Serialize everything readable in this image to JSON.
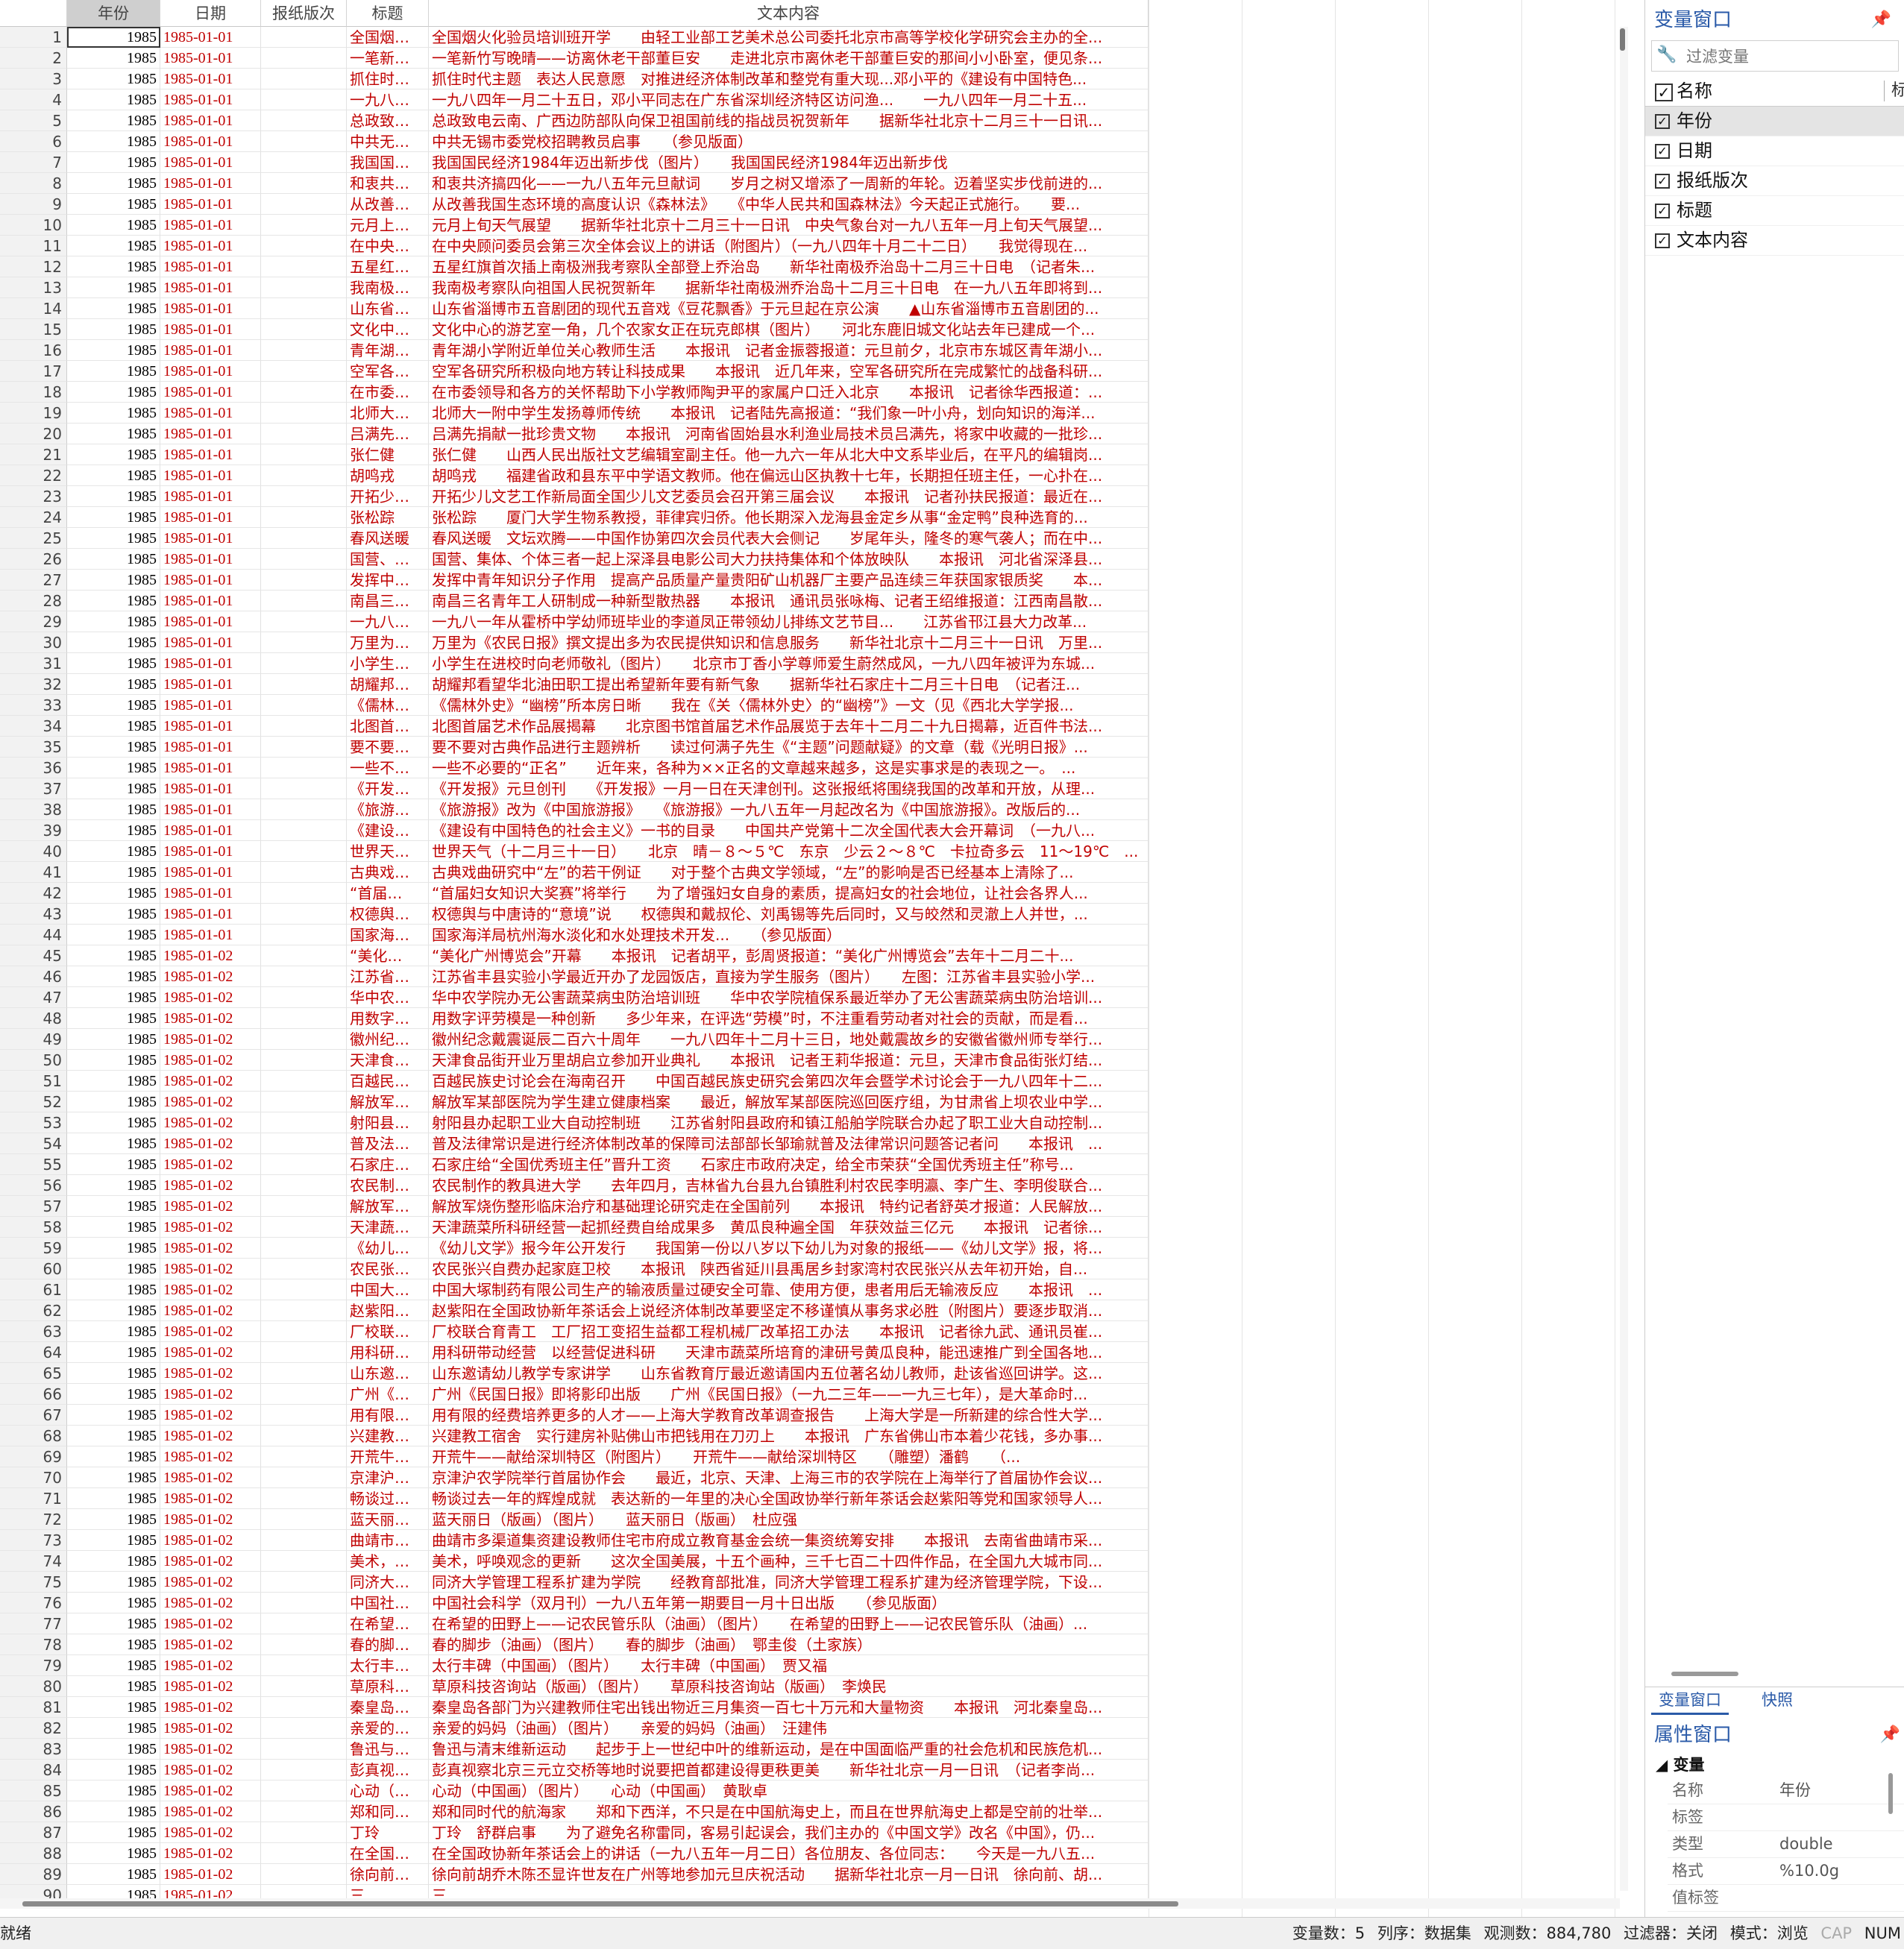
{
  "grid": {
    "headers": [
      "年份",
      "日期",
      "报纸版次",
      "标题",
      "文本内容"
    ],
    "rows": [
      {
        "n": "1",
        "year": "1985",
        "date": "1985-01-01",
        "edition": "",
        "title": "全国烟…",
        "text": "全国烟火化验员培训班开学　　由轻工业部工艺美术总公司委托北京市高等学校化学研究会主办的全..."
      },
      {
        "n": "2",
        "year": "1985",
        "date": "1985-01-01",
        "edition": "",
        "title": "一笔新…",
        "text": "一笔新竹写晚晴——访离休老干部董巨安　　走进北京市离休老干部董巨安的那间小小卧室，便见条..."
      },
      {
        "n": "3",
        "year": "1985",
        "date": "1985-01-01",
        "edition": "",
        "title": "抓住时…",
        "text": "抓住时代主题　表达人民意愿　对推进经济体制改革和整党有重大现...邓小平的《建设有中国特色..."
      },
      {
        "n": "4",
        "year": "1985",
        "date": "1985-01-01",
        "edition": "",
        "title": "一九八…",
        "text": "一九八四年一月二十五日，邓小平同志在广东省深圳经济特区访问渔...　　一九八四年一月二十五..."
      },
      {
        "n": "5",
        "year": "1985",
        "date": "1985-01-01",
        "edition": "",
        "title": "总政致…",
        "text": "总政致电云南、广西边防部队向保卫祖国前线的指战员祝贺新年　　据新华社北京十二月三十一日讯..."
      },
      {
        "n": "6",
        "year": "1985",
        "date": "1985-01-01",
        "edition": "",
        "title": "中共无…",
        "text": "中共无锡市委党校招聘教员启事　　（参见版面）"
      },
      {
        "n": "7",
        "year": "1985",
        "date": "1985-01-01",
        "edition": "",
        "title": "我国国…",
        "text": "我国国民经济1984年迈出新步伐（图片）　　我国国民经济1984年迈出新步伐"
      },
      {
        "n": "8",
        "year": "1985",
        "date": "1985-01-01",
        "edition": "",
        "title": "和衷共…",
        "text": "和衷共济搞四化——一九八五年元旦献词　　岁月之树又增添了一周新的年轮。迈着坚实步伐前进的..."
      },
      {
        "n": "9",
        "year": "1985",
        "date": "1985-01-01",
        "edition": "",
        "title": "从改善…",
        "text": "从改善我国生态环境的高度认识《森林法》　　《中华人民共和国森林法》今天起正式施行。　　要..."
      },
      {
        "n": "10",
        "year": "1985",
        "date": "1985-01-01",
        "edition": "",
        "title": "元月上…",
        "text": "元月上旬天气展望　　据新华社北京十二月三十一日讯　中央气象台对一九八五年一月上旬天气展望..."
      },
      {
        "n": "11",
        "year": "1985",
        "date": "1985-01-01",
        "edition": "",
        "title": "在中央…",
        "text": "在中央顾问委员会第三次全体会议上的讲话（附图片）（一九八四年十月二十二日）　　我觉得现在..."
      },
      {
        "n": "12",
        "year": "1985",
        "date": "1985-01-01",
        "edition": "",
        "title": "五星红…",
        "text": "五星红旗首次插上南极洲我考察队全部登上乔治岛　　新华社南极乔治岛十二月三十日电　（记者朱..."
      },
      {
        "n": "13",
        "year": "1985",
        "date": "1985-01-01",
        "edition": "",
        "title": "我南极…",
        "text": "我南极考察队向祖国人民祝贺新年　　据新华社南极洲乔治岛十二月三十日电　在一九八五年即将到..."
      },
      {
        "n": "14",
        "year": "1985",
        "date": "1985-01-01",
        "edition": "",
        "title": "山东省…",
        "text": "山东省淄博市五音剧团的现代五音戏《豆花飘香》于元旦起在京公演　　▲山东省淄博市五音剧团的..."
      },
      {
        "n": "15",
        "year": "1985",
        "date": "1985-01-01",
        "edition": "",
        "title": "文化中…",
        "text": "文化中心的游艺室一角，几个农家女正在玩克郎棋（图片）　　河北东鹿旧城文化站去年已建成一个..."
      },
      {
        "n": "16",
        "year": "1985",
        "date": "1985-01-01",
        "edition": "",
        "title": "青年湖…",
        "text": "青年湖小学附近单位关心教师生活　　本报讯　记者金振蓉报道：元旦前夕，北京市东城区青年湖小..."
      },
      {
        "n": "17",
        "year": "1985",
        "date": "1985-01-01",
        "edition": "",
        "title": "空军各…",
        "text": "空军各研究所积极向地方转让科技成果　　本报讯　近几年来，空军各研究所在完成繁忙的战备科研..."
      },
      {
        "n": "18",
        "year": "1985",
        "date": "1985-01-01",
        "edition": "",
        "title": "在市委…",
        "text": "在市委领导和各方的关怀帮助下小学教师陶尹平的家属户口迁入北京　　本报讯　记者徐华西报道：..."
      },
      {
        "n": "19",
        "year": "1985",
        "date": "1985-01-01",
        "edition": "",
        "title": "北师大…",
        "text": "北师大一附中学生发扬尊师传统　　本报讯　记者陆先高报道：“我们象一叶小舟，划向知识的海洋..."
      },
      {
        "n": "20",
        "year": "1985",
        "date": "1985-01-01",
        "edition": "",
        "title": "吕满先…",
        "text": "吕满先捐献一批珍贵文物　　本报讯　河南省固始县水利渔业局技术员吕满先，将家中收藏的一批珍..."
      },
      {
        "n": "21",
        "year": "1985",
        "date": "1985-01-01",
        "edition": "",
        "title": "张仁健",
        "text": "张仁健　　山西人民出版社文艺编辑室副主任。他一九六一年从北大中文系毕业后，在平凡的编辑岗..."
      },
      {
        "n": "22",
        "year": "1985",
        "date": "1985-01-01",
        "edition": "",
        "title": "胡鸣戎",
        "text": "胡鸣戎　　福建省政和县东平中学语文教师。他在偏远山区执教十七年，长期担任班主任，一心扑在..."
      },
      {
        "n": "23",
        "year": "1985",
        "date": "1985-01-01",
        "edition": "",
        "title": "开拓少…",
        "text": "开拓少儿文艺工作新局面全国少儿文艺委员会召开第三届会议　　本报讯　记者孙扶民报道：最近在..."
      },
      {
        "n": "24",
        "year": "1985",
        "date": "1985-01-01",
        "edition": "",
        "title": "张松踪",
        "text": "张松踪　　厦门大学生物系教授，菲律宾归侨。他长期深入龙海县金定乡从事“金定鸭”良种选育的..."
      },
      {
        "n": "25",
        "year": "1985",
        "date": "1985-01-01",
        "edition": "",
        "title": "春风送暖",
        "text": "春风送暖　文坛欢腾——中国作协第四次会员代表大会侧记　　岁尾年头，隆冬的寒气袭人；而在中..."
      },
      {
        "n": "26",
        "year": "1985",
        "date": "1985-01-01",
        "edition": "",
        "title": "国营、…",
        "text": "国营、集体、个体三者一起上深泽县电影公司大力扶持集体和个体放映队　　本报讯　河北省深泽县..."
      },
      {
        "n": "27",
        "year": "1985",
        "date": "1985-01-01",
        "edition": "",
        "title": "发挥中…",
        "text": "发挥中青年知识分子作用　提高产品质量产量贵阳矿山机器厂主要产品连续三年获国家银质奖　　本..."
      },
      {
        "n": "28",
        "year": "1985",
        "date": "1985-01-01",
        "edition": "",
        "title": "南昌三…",
        "text": "南昌三名青年工人研制成一种新型散热器　　本报讯　通讯员张咏梅、记者王绍维报道：江西南昌散..."
      },
      {
        "n": "29",
        "year": "1985",
        "date": "1985-01-01",
        "edition": "",
        "title": "一九八…",
        "text": "一九八一年从霍桥中学幼师班毕业的李道凤正带领幼儿排练文艺节目...　　江苏省邗江县大力改革..."
      },
      {
        "n": "30",
        "year": "1985",
        "date": "1985-01-01",
        "edition": "",
        "title": "万里为…",
        "text": "万里为《农民日报》撰文提出多为农民提供知识和信息服务　　新华社北京十二月三十一日讯　万里..."
      },
      {
        "n": "31",
        "year": "1985",
        "date": "1985-01-01",
        "edition": "",
        "title": "小学生…",
        "text": "小学生在进校时向老师敬礼（图片）　　北京市丁香小学尊师爱生蔚然成风，一九八四年被评为东城..."
      },
      {
        "n": "32",
        "year": "1985",
        "date": "1985-01-01",
        "edition": "",
        "title": "胡耀邦…",
        "text": "胡耀邦看望华北油田职工提出希望新年要有新气象　　据新华社石家庄十二月三十日电　（记者汪..."
      },
      {
        "n": "33",
        "year": "1985",
        "date": "1985-01-01",
        "edition": "",
        "title": "《儒林…",
        "text": "《儒林外史》“幽榜”所本房日晰　　我在《关〈儒林外史〉的“幽榜”》一文（见《西北大学学报..."
      },
      {
        "n": "34",
        "year": "1985",
        "date": "1985-01-01",
        "edition": "",
        "title": "北图首…",
        "text": "北图首届艺术作品展揭幕　　北京图书馆首届艺术作品展览于去年十二月二十九日揭幕，近百件书法..."
      },
      {
        "n": "35",
        "year": "1985",
        "date": "1985-01-01",
        "edition": "",
        "title": "要不要…",
        "text": "要不要对古典作品进行主题辨析　　读过何满子先生《“主题”问题献疑》的文章（载《光明日报》..."
      },
      {
        "n": "36",
        "year": "1985",
        "date": "1985-01-01",
        "edition": "",
        "title": "一些不…",
        "text": "一些不必要的“正名”　　近年来，各种为××正名的文章越来越多，这是实事求是的表现之一。　..."
      },
      {
        "n": "37",
        "year": "1985",
        "date": "1985-01-01",
        "edition": "",
        "title": "《开发…",
        "text": "《开发报》元旦创刊　　《开发报》一月一日在天津创刊。这张报纸将围绕我国的改革和开放，从理..."
      },
      {
        "n": "38",
        "year": "1985",
        "date": "1985-01-01",
        "edition": "",
        "title": "《旅游…",
        "text": "《旅游报》改为《中国旅游报》　　《旅游报》一九八五年一月起改名为《中国旅游报》。改版后的..."
      },
      {
        "n": "39",
        "year": "1985",
        "date": "1985-01-01",
        "edition": "",
        "title": "《建设…",
        "text": "《建设有中国特色的社会主义》一书的目录　　中国共产党第十二次全国代表大会开幕词　（一九八..."
      },
      {
        "n": "40",
        "year": "1985",
        "date": "1985-01-01",
        "edition": "",
        "title": "世界天…",
        "text": "世界天气（十二月三十一日）　　北京　晴－８～５℃　东京　少云２～８℃　卡拉奇多云　11～19℃　..."
      },
      {
        "n": "41",
        "year": "1985",
        "date": "1985-01-01",
        "edition": "",
        "title": "古典戏…",
        "text": "古典戏曲研究中“左”的若干例证　　对于整个古典文学领域，“左”的影响是否已经基本上清除了..."
      },
      {
        "n": "42",
        "year": "1985",
        "date": "1985-01-01",
        "edition": "",
        "title": "“首届…",
        "text": "“首届妇女知识大奖赛”将举行　　为了增强妇女自身的素质，提高妇女的社会地位，让社会各界人..."
      },
      {
        "n": "43",
        "year": "1985",
        "date": "1985-01-01",
        "edition": "",
        "title": "权德舆…",
        "text": "权德舆与中唐诗的“意境”说　　权德舆和戴叔伦、刘禹锡等先后同时，又与皎然和灵澈上人并世，..."
      },
      {
        "n": "44",
        "year": "1985",
        "date": "1985-01-01",
        "edition": "",
        "title": "国家海…",
        "text": "国家海洋局杭州海水淡化和水处理技术开发...　　（参见版面）"
      },
      {
        "n": "45",
        "year": "1985",
        "date": "1985-01-02",
        "edition": "",
        "title": "“美化…",
        "text": "“美化广州博览会”开幕　　本报讯　记者胡平，彭周贤报道：“美化广州博览会”去年十二月二十..."
      },
      {
        "n": "46",
        "year": "1985",
        "date": "1985-01-02",
        "edition": "",
        "title": "江苏省…",
        "text": "江苏省丰县实验小学最近开办了龙园饭店，直接为学生服务（图片）　　左图：江苏省丰县实验小学..."
      },
      {
        "n": "47",
        "year": "1985",
        "date": "1985-01-02",
        "edition": "",
        "title": "华中农…",
        "text": "华中农学院办无公害蔬菜病虫防治培训班　　华中农学院植保系最近举办了无公害蔬菜病虫防治培训..."
      },
      {
        "n": "48",
        "year": "1985",
        "date": "1985-01-02",
        "edition": "",
        "title": "用数字…",
        "text": "用数字评劳模是一种创新　　多少年来，在评选“劳模”时，不注重看劳动者对社会的贡献，而是看..."
      },
      {
        "n": "49",
        "year": "1985",
        "date": "1985-01-02",
        "edition": "",
        "title": "徽州纪…",
        "text": "徽州纪念戴震诞辰二百六十周年　　一九八四年十二月十三日，地处戴震故乡的安徽省徽州师专举行..."
      },
      {
        "n": "50",
        "year": "1985",
        "date": "1985-01-02",
        "edition": "",
        "title": "天津食…",
        "text": "天津食品街开业万里胡启立参加开业典礼　　本报讯　记者王莉华报道：元旦，天津市食品街张灯结..."
      },
      {
        "n": "51",
        "year": "1985",
        "date": "1985-01-02",
        "edition": "",
        "title": "百越民…",
        "text": "百越民族史讨论会在海南召开　　中国百越民族史研究会第四次年会暨学术讨论会于一九八四年十二..."
      },
      {
        "n": "52",
        "year": "1985",
        "date": "1985-01-02",
        "edition": "",
        "title": "解放军…",
        "text": "解放军某部医院为学生建立健康档案　　最近，解放军某部医院巡回医疗组，为甘肃省上坝农业中学..."
      },
      {
        "n": "53",
        "year": "1985",
        "date": "1985-01-02",
        "edition": "",
        "title": "射阳县…",
        "text": "射阳县办起职工业大自动控制班　　江苏省射阳县政府和镇江船舶学院联合办起了职工业大自动控制..."
      },
      {
        "n": "54",
        "year": "1985",
        "date": "1985-01-02",
        "edition": "",
        "title": "普及法…",
        "text": "普及法律常识是进行经济体制改革的保障司法部部长邹瑜就普及法律常识问题答记者问　　本报讯　..."
      },
      {
        "n": "55",
        "year": "1985",
        "date": "1985-01-02",
        "edition": "",
        "title": "石家庄…",
        "text": "石家庄给“全国优秀班主任”晋升工资　　石家庄市政府决定，给全市荣获“全国优秀班主任”称号..."
      },
      {
        "n": "56",
        "year": "1985",
        "date": "1985-01-02",
        "edition": "",
        "title": "农民制…",
        "text": "农民制作的教具进大学　　去年四月，吉林省九台县九台镇胜利村农民李明瀛、李广生、李明俊联合..."
      },
      {
        "n": "57",
        "year": "1985",
        "date": "1985-01-02",
        "edition": "",
        "title": "解放军…",
        "text": "解放军烧伤整形临床治疗和基础理论研究走在全国前列　　本报讯　特约记者舒英才报道：人民解放..."
      },
      {
        "n": "58",
        "year": "1985",
        "date": "1985-01-02",
        "edition": "",
        "title": "天津蔬…",
        "text": "天津蔬菜所科研经营一起抓经费自给成果多　黄瓜良种遍全国　年获效益三亿元　　本报讯　记者徐..."
      },
      {
        "n": "59",
        "year": "1985",
        "date": "1985-01-02",
        "edition": "",
        "title": "《幼儿…",
        "text": "《幼儿文学》报今年公开发行　　我国第一份以八岁以下幼儿为对象的报纸——《幼儿文学》报，将..."
      },
      {
        "n": "60",
        "year": "1985",
        "date": "1985-01-02",
        "edition": "",
        "title": "农民张…",
        "text": "农民张兴自费办起家庭卫校　　本报讯　陕西省延川县禹居乡封家湾村农民张兴从去年初开始，自..."
      },
      {
        "n": "61",
        "year": "1985",
        "date": "1985-01-02",
        "edition": "",
        "title": "中国大…",
        "text": "中国大塚制药有限公司生产的输液质量过硬安全可靠、使用方便，患者用后无输液反应　　本报讯　..."
      },
      {
        "n": "62",
        "year": "1985",
        "date": "1985-01-02",
        "edition": "",
        "title": "赵紫阳…",
        "text": "赵紫阳在全国政协新年茶话会上说经济体制改革要坚定不移谨慎从事务求必胜（附图片）要逐步取消..."
      },
      {
        "n": "63",
        "year": "1985",
        "date": "1985-01-02",
        "edition": "",
        "title": "厂校联…",
        "text": "厂校联合育青工　工厂招工变招生益都工程机械厂改革招工办法　　本报讯　记者徐九武、通讯员崔..."
      },
      {
        "n": "64",
        "year": "1985",
        "date": "1985-01-02",
        "edition": "",
        "title": "用科研…",
        "text": "用科研带动经营　以经营促进科研　　天津市蔬菜所培育的津研号黄瓜良种，能迅速推广到全国各地..."
      },
      {
        "n": "65",
        "year": "1985",
        "date": "1985-01-02",
        "edition": "",
        "title": "山东邀…",
        "text": "山东邀请幼儿教学专家讲学　　山东省教育厅最近邀请国内五位著名幼儿教师，赴该省巡回讲学。这..."
      },
      {
        "n": "66",
        "year": "1985",
        "date": "1985-01-02",
        "edition": "",
        "title": "广州《…",
        "text": "广州《民国日报》即将影印出版　　广州《民国日报》（一九二三年——一九三七年），是大革命时..."
      },
      {
        "n": "67",
        "year": "1985",
        "date": "1985-01-02",
        "edition": "",
        "title": "用有限…",
        "text": "用有限的经费培养更多的人才——上海大学教育改革调查报告　　上海大学是一所新建的综合性大学..."
      },
      {
        "n": "68",
        "year": "1985",
        "date": "1985-01-02",
        "edition": "",
        "title": "兴建教…",
        "text": "兴建教工宿舍　实行建房补贴佛山市把钱用在刀刃上　　本报讯　广东省佛山市本着少花钱，多办事..."
      },
      {
        "n": "69",
        "year": "1985",
        "date": "1985-01-02",
        "edition": "",
        "title": "开荒牛…",
        "text": "开荒牛——献给深圳特区（附图片）　　开荒牛——献给深圳特区　　（雕塑）潘鹤　　（..."
      },
      {
        "n": "70",
        "year": "1985",
        "date": "1985-01-02",
        "edition": "",
        "title": "京津沪…",
        "text": "京津沪农学院举行首届协作会　　最近，北京、天津、上海三市的农学院在上海举行了首届协作会议..."
      },
      {
        "n": "71",
        "year": "1985",
        "date": "1985-01-02",
        "edition": "",
        "title": "畅谈过…",
        "text": "畅谈过去一年的辉煌成就　表达新的一年里的决心全国政协举行新年茶话会赵紫阳等党和国家领导人..."
      },
      {
        "n": "72",
        "year": "1985",
        "date": "1985-01-02",
        "edition": "",
        "title": "蓝天丽…",
        "text": "蓝天丽日（版画）（图片）　　蓝天丽日（版画）　杜应强"
      },
      {
        "n": "73",
        "year": "1985",
        "date": "1985-01-02",
        "edition": "",
        "title": "曲靖市…",
        "text": "曲靖市多渠道集资建设教师住宅市府成立教育基金会统一集资统筹安排　　本报讯　去南省曲靖市采..."
      },
      {
        "n": "74",
        "year": "1985",
        "date": "1985-01-02",
        "edition": "",
        "title": "美术，…",
        "text": "美术，呼唤观念的更新　　这次全国美展，十五个画种，三千七百二十四件作品，在全国九大城市同..."
      },
      {
        "n": "75",
        "year": "1985",
        "date": "1985-01-02",
        "edition": "",
        "title": "同济大…",
        "text": "同济大学管理工程系扩建为学院　　经教育部批准，同济大学管理工程系扩建为经济管理学院，下设..."
      },
      {
        "n": "76",
        "year": "1985",
        "date": "1985-01-02",
        "edition": "",
        "title": "中国社…",
        "text": "中国社会科学（双月刊）一九八五年第一期要目一月十日出版　　（参见版面）"
      },
      {
        "n": "77",
        "year": "1985",
        "date": "1985-01-02",
        "edition": "",
        "title": "在希望…",
        "text": "在希望的田野上——记农民管乐队（油画）（图片）　　在希望的田野上——记农民管乐队（油画）..."
      },
      {
        "n": "78",
        "year": "1985",
        "date": "1985-01-02",
        "edition": "",
        "title": "春的脚…",
        "text": "春的脚步（油画）（图片）　　春的脚步（油画）　鄂圭俊（土家族）"
      },
      {
        "n": "79",
        "year": "1985",
        "date": "1985-01-02",
        "edition": "",
        "title": "太行丰…",
        "text": "太行丰碑（中国画）（图片）　　太行丰碑（中国画）　贾又福"
      },
      {
        "n": "80",
        "year": "1985",
        "date": "1985-01-02",
        "edition": "",
        "title": "草原科…",
        "text": "草原科技咨询站（版画）（图片）　　草原科技咨询站（版画）　李焕民"
      },
      {
        "n": "81",
        "year": "1985",
        "date": "1985-01-02",
        "edition": "",
        "title": "秦皇岛…",
        "text": "秦皇岛各部门为兴建教师住宅出钱出物近三月集资一百七十万元和大量物资　　本报讯　河北秦皇岛..."
      },
      {
        "n": "82",
        "year": "1985",
        "date": "1985-01-02",
        "edition": "",
        "title": "亲爱的…",
        "text": "亲爱的妈妈（油画）（图片）　　亲爱的妈妈（油画）　汪建伟"
      },
      {
        "n": "83",
        "year": "1985",
        "date": "1985-01-02",
        "edition": "",
        "title": "鲁迅与…",
        "text": "鲁迅与清末维新运动　　起步于上一世纪中叶的维新运动，是在中国面临严重的社会危机和民族危机..."
      },
      {
        "n": "84",
        "year": "1985",
        "date": "1985-01-02",
        "edition": "",
        "title": "彭真视…",
        "text": "彭真视察北京三元立交桥等地时说要把首都建设得更秩更美　　新华社北京一月一日讯　（记者李尚..."
      },
      {
        "n": "85",
        "year": "1985",
        "date": "1985-01-02",
        "edition": "",
        "title": "心动（…",
        "text": "心动（中国画）（图片）　　心动（中国画）　黄耿卓"
      },
      {
        "n": "86",
        "year": "1985",
        "date": "1985-01-02",
        "edition": "",
        "title": "郑和同…",
        "text": "郑和同时代的航海家　　郑和下西洋，不只是在中国航海史上，而且在世界航海史上都是空前的壮举..."
      },
      {
        "n": "87",
        "year": "1985",
        "date": "1985-01-02",
        "edition": "",
        "title": "丁玲",
        "text": "丁玲　舒群启事　　为了避免名称雷同，客易引起误会，我们主办的《中国文学》改名《中国》，仍..."
      },
      {
        "n": "88",
        "year": "1985",
        "date": "1985-01-02",
        "edition": "",
        "title": "在全国…",
        "text": "在全国政协新年茶话会上的讲话（一九八五年一月二日）各位朋友、各位同志：　　今天是一九八五..."
      },
      {
        "n": "89",
        "year": "1985",
        "date": "1985-01-02",
        "edition": "",
        "title": "徐向前…",
        "text": "徐向前胡乔木陈丕显许世友在广州等地参加元旦庆祝活动　　据新华社北京一月一日讯　徐向前、胡..."
      },
      {
        "n": "90",
        "year": "1985",
        "date": "1985-01-02",
        "edition": "",
        "title": "三…",
        "text": "三…"
      }
    ]
  },
  "var_window": {
    "title": "变量窗口",
    "pin": "📌",
    "filter_placeholder": "过滤变量",
    "name_header": "名称",
    "label_header": "标",
    "items": [
      "年份",
      "日期",
      "报纸版次",
      "标题",
      "文本内容"
    ],
    "tabs": [
      "变量窗口",
      "快照"
    ]
  },
  "prop_window": {
    "title": "属性窗口",
    "section": "变量",
    "rows": [
      {
        "k": "名称",
        "v": "年份"
      },
      {
        "k": "标签",
        "v": ""
      },
      {
        "k": "类型",
        "v": "double"
      },
      {
        "k": "格式",
        "v": "%10.0g"
      },
      {
        "k": "值标签",
        "v": ""
      }
    ]
  },
  "status": {
    "left": "就绪",
    "vars": "变量数：5",
    "order": "列序：数据集",
    "obs": "观测数：884,780",
    "filter": "过滤器：关闭",
    "mode": "模式：浏览",
    "cap": "CAP",
    "num": "NUM"
  }
}
